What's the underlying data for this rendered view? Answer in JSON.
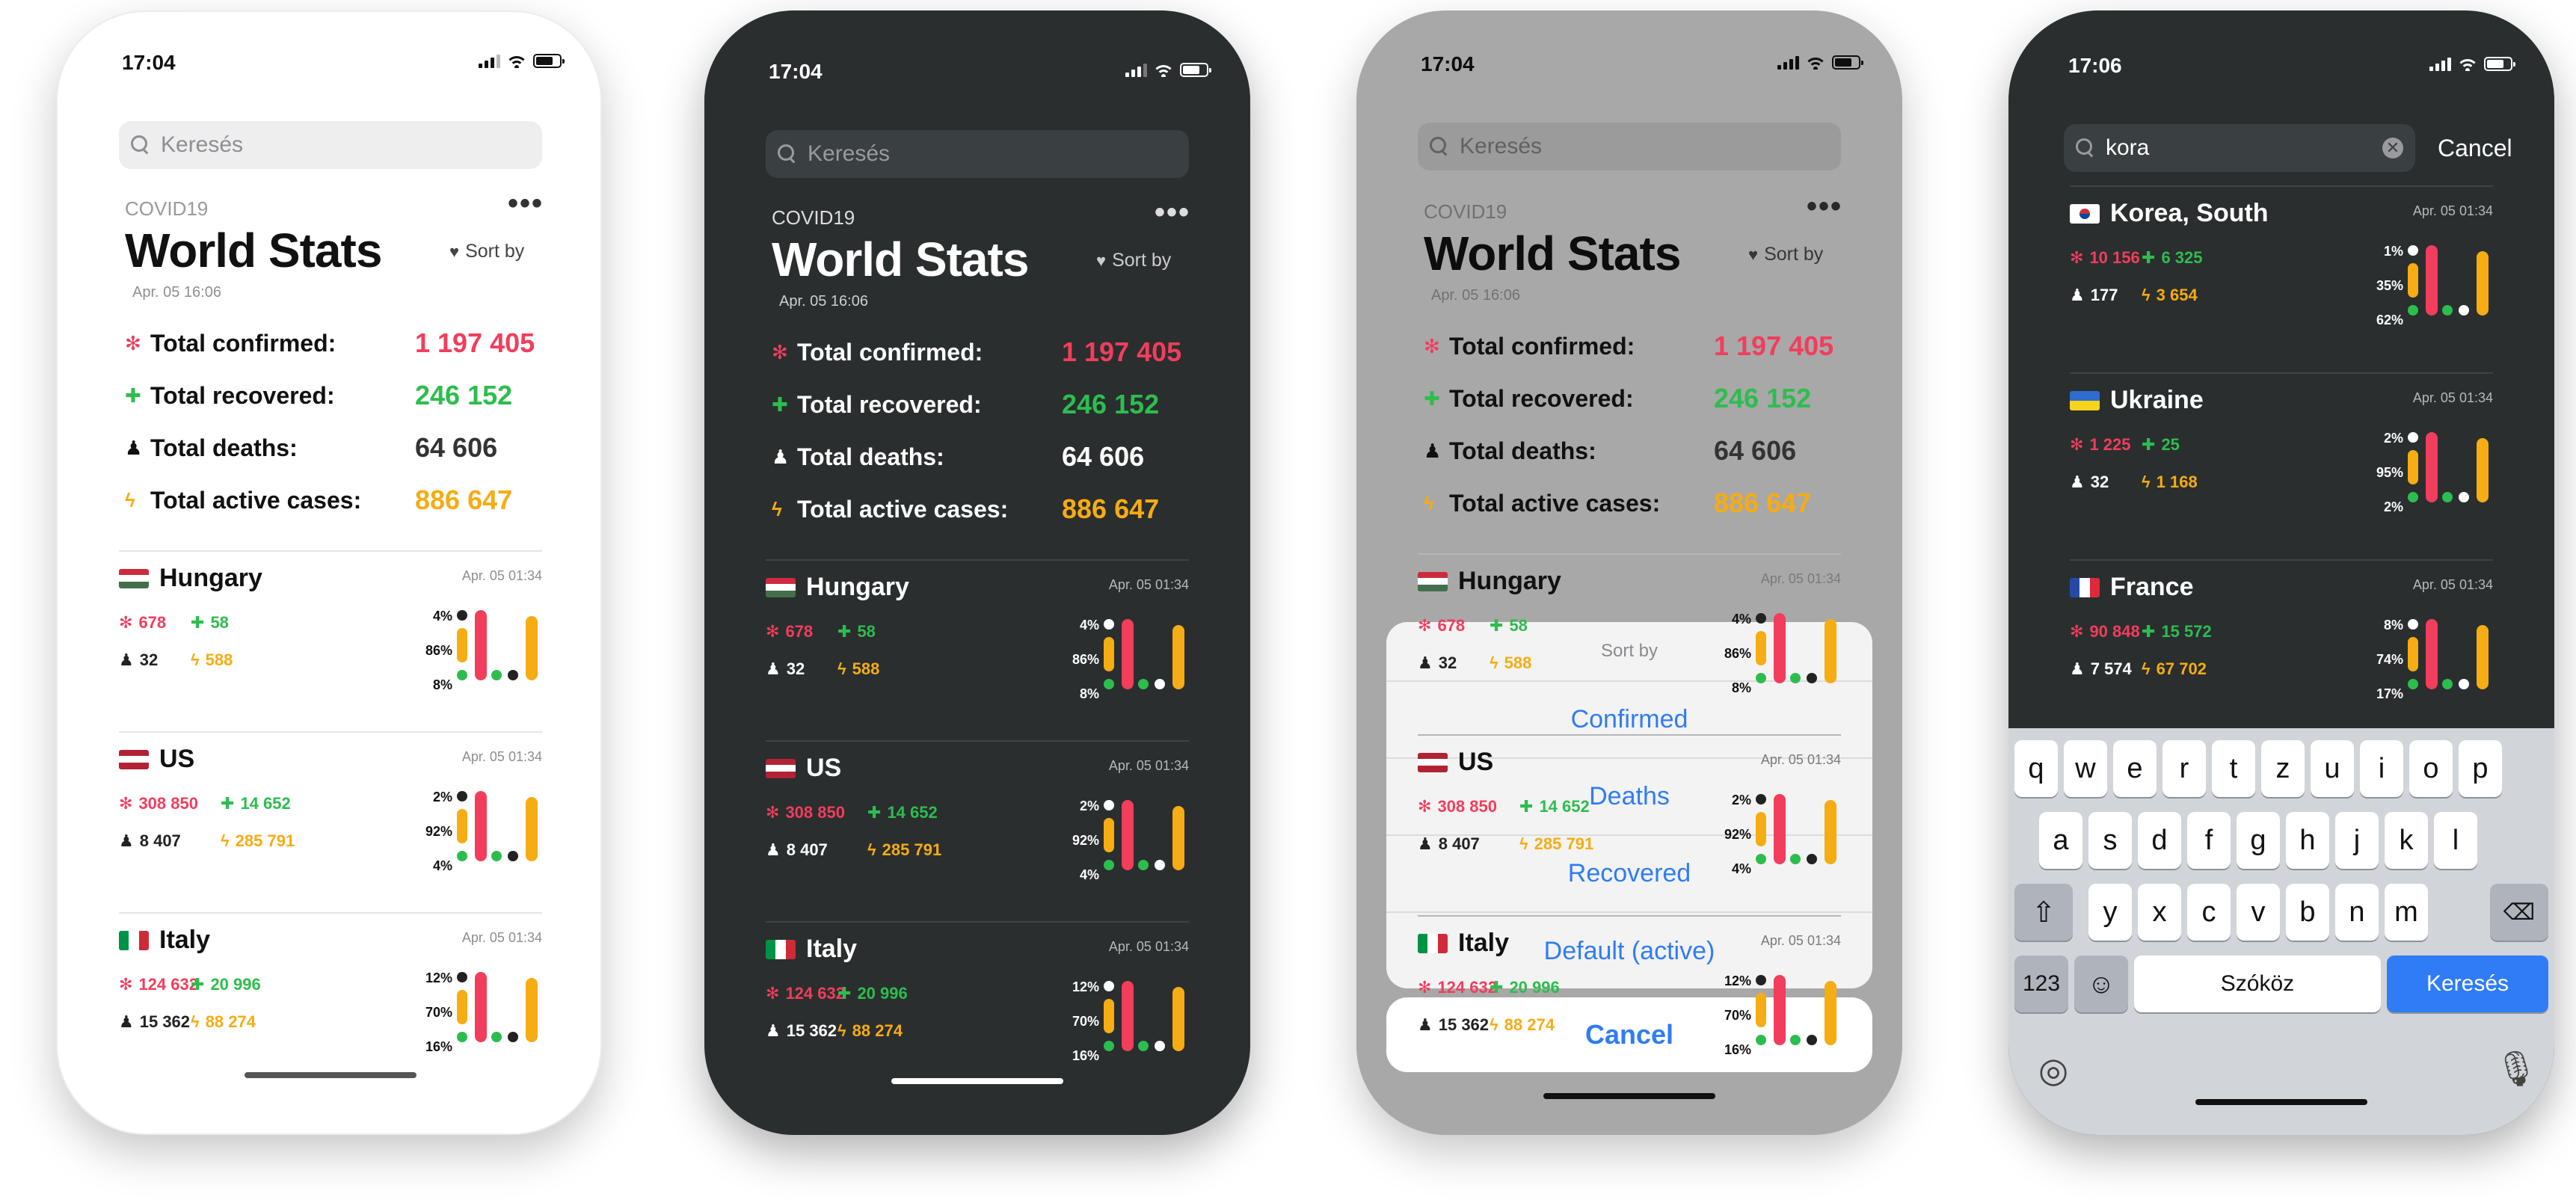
{
  "colors": {
    "confirmed": "#f23d5c",
    "recovered": "#2dbd4e",
    "deaths_light": "#222222",
    "deaths_dark": "#ffffff",
    "active": "#f6ac13",
    "link": "#2f7cf6"
  },
  "icons": {
    "confirmed": "virus-icon",
    "recovered": "cross-icon",
    "deaths": "grave-icon",
    "active": "bolt-icon"
  },
  "phones": [
    {
      "time": "17:04",
      "search_placeholder": "Keresés",
      "overline": "COVID19",
      "title": "World Stats",
      "date": "Apr. 05 16:06",
      "sort_label": "Sort by"
    },
    {
      "time": "17:04",
      "search_placeholder": "Keresés",
      "overline": "COVID19",
      "title": "World Stats",
      "date": "Apr. 05 16:06",
      "sort_label": "Sort by"
    },
    {
      "time": "17:04",
      "search_placeholder": "Keresés",
      "overline": "COVID19",
      "title": "World Stats",
      "date": "Apr. 05 16:06",
      "sort_label": "Sort by"
    },
    {
      "time": "17:06",
      "search_value": "kora",
      "cancel_label": "Cancel"
    }
  ],
  "totals": [
    {
      "icon": "✻",
      "label": "Total confirmed:",
      "value": "1 197 405"
    },
    {
      "icon": "✚",
      "label": "Total recovered:",
      "value": "246 152"
    },
    {
      "icon": "♟",
      "label": "Total deaths:",
      "value": "64 606"
    },
    {
      "icon": "ϟ",
      "label": "Total active cases:",
      "value": "886 647"
    }
  ],
  "countries": [
    {
      "name": "Hungary",
      "date": "Apr. 05 01:34",
      "confirmed": "678",
      "recovered": "58",
      "deaths": "32",
      "active": "588",
      "p1": "4%",
      "p2": "86%",
      "p3": "8%",
      "flag": [
        "#cd2a3e",
        "#ffffff",
        "#436f4d"
      ]
    },
    {
      "name": "US",
      "date": "Apr. 05 01:34",
      "confirmed": "308 850",
      "recovered": "14 652",
      "deaths": "8 407",
      "active": "285 791",
      "p1": "2%",
      "p2": "92%",
      "p3": "4%",
      "flag": [
        "#b22234",
        "#ffffff",
        "#b22234"
      ]
    },
    {
      "name": "Italy",
      "date": "Apr. 05 01:34",
      "confirmed": "124 632",
      "recovered": "20 996",
      "deaths": "15 362",
      "active": "88 274",
      "p1": "12%",
      "p2": "70%",
      "p3": "16%",
      "flag": [
        "v",
        "#009246",
        "#ffffff",
        "#ce2b37"
      ]
    }
  ],
  "search_results": [
    {
      "name": "Korea, South",
      "date": "Apr. 05 01:34",
      "confirmed": "10 156",
      "recovered": "6 325",
      "deaths": "177",
      "active": "3 654",
      "p1": "1%",
      "p2": "35%",
      "p3": "62%"
    },
    {
      "name": "Ukraine",
      "date": "Apr. 05 01:34",
      "confirmed": "1 225",
      "recovered": "25",
      "deaths": "32",
      "active": "1 168",
      "p1": "2%",
      "p2": "95%",
      "p3": "2%"
    },
    {
      "name": "France",
      "date": "Apr. 05 01:34",
      "confirmed": "90 848",
      "recovered": "15 572",
      "deaths": "7 574",
      "active": "67 702",
      "p1": "8%",
      "p2": "74%",
      "p3": "17%"
    }
  ],
  "sort_sheet": {
    "title": "Sort by",
    "options": [
      "Confirmed",
      "Deaths",
      "Recovered",
      "Default (active)"
    ],
    "cancel": "Cancel"
  },
  "keyboard": {
    "row1": [
      "q",
      "w",
      "e",
      "r",
      "t",
      "z",
      "u",
      "i",
      "o",
      "p"
    ],
    "row2": [
      "a",
      "s",
      "d",
      "f",
      "g",
      "h",
      "j",
      "k",
      "l"
    ],
    "row3": [
      "y",
      "x",
      "c",
      "v",
      "b",
      "n",
      "m"
    ],
    "numbers": "123",
    "space": "Szóköz",
    "go": "Keresés"
  }
}
